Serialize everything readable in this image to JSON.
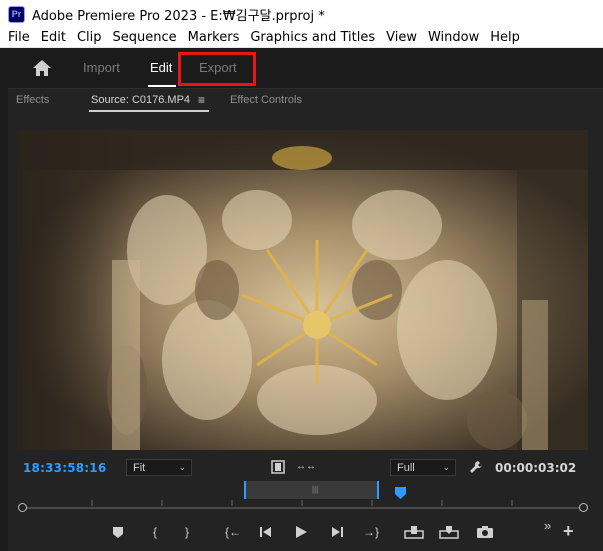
{
  "window": {
    "app_logo_text": "Pr",
    "title": "Adobe Premiere Pro 2023 - E:₩김구달.prproj *"
  },
  "menu": [
    "File",
    "Edit",
    "Clip",
    "Sequence",
    "Markers",
    "Graphics and Titles",
    "View",
    "Window",
    "Help"
  ],
  "workspaces": {
    "home_icon": "home-icon",
    "import_label": "Import",
    "edit_label": "Edit",
    "export_label": "Export",
    "active": "Edit",
    "highlighted": "Export",
    "highlight_color": "#e61616"
  },
  "panel_tabs": {
    "effects_label": "Effects",
    "source_label": "Source: C0176.MP4",
    "source_menu_glyph": "≡",
    "effect_controls_label": "Effect Controls"
  },
  "monitor": {
    "timecode": "18:33:58:16",
    "timecode_color": "#2f9bff",
    "zoom_value": "Fit",
    "resolution_value": "Full",
    "duration": "00:00:03:02"
  },
  "transport_icons": [
    "add-marker-icon",
    "mark-in-icon",
    "mark-out-icon",
    "go-to-in-icon",
    "step-back-icon",
    "play-icon",
    "step-forward-icon",
    "go-to-out-icon",
    "insert-icon",
    "overwrite-icon",
    "export-frame-icon",
    "button-editor-icon",
    "add-button-icon"
  ]
}
